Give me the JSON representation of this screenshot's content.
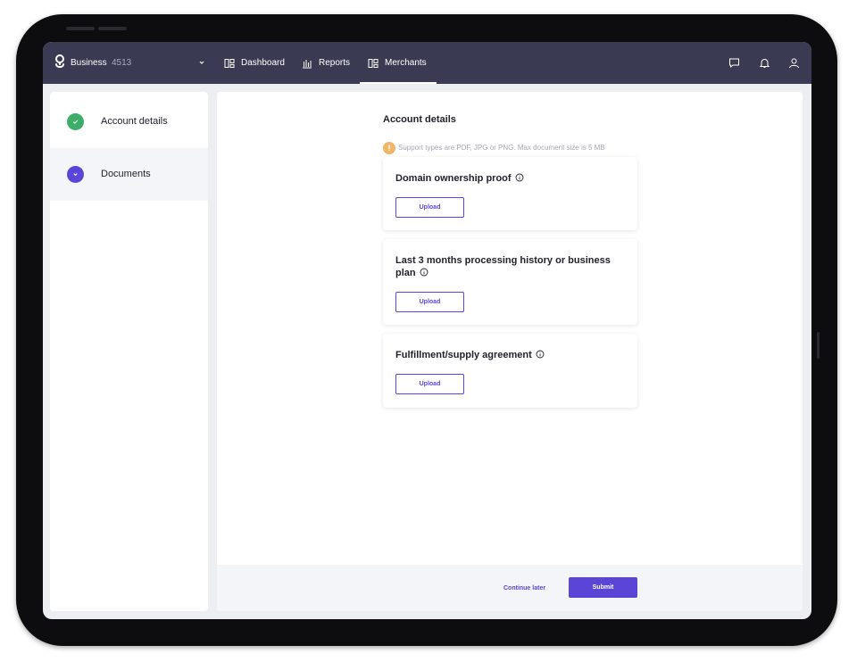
{
  "header": {
    "business_label": "Business",
    "business_number": "4513",
    "nav": [
      {
        "label": "Dashboard",
        "icon": "dashboard-icon"
      },
      {
        "label": "Reports",
        "icon": "reports-icon"
      },
      {
        "label": "Merchants",
        "icon": "merchants-icon",
        "active": true
      }
    ],
    "icons": [
      "chat-icon",
      "bell-icon",
      "user-icon"
    ]
  },
  "sidebar": {
    "steps": [
      {
        "label": "Account details",
        "status": "complete",
        "color": "#3dae6a"
      },
      {
        "label": "Documents",
        "status": "current",
        "color": "#5b45d6"
      }
    ]
  },
  "main": {
    "title": "Account details",
    "hint": "Support types are PDF, JPG or PNG. Max document size is 5 MB",
    "hint_icon": "!",
    "documents": [
      {
        "title": "Domain ownership proof",
        "button": "Upload"
      },
      {
        "title": "Last 3 months processing history or business plan",
        "button": "Upload"
      },
      {
        "title": "Fulfillment/supply agreement",
        "button": "Upload"
      }
    ],
    "footer": {
      "continue_label": "Continue later",
      "submit_label": "Submit"
    }
  },
  "colors": {
    "topbar": "#3a3b52",
    "accent": "#5b45d6",
    "success": "#3dae6a",
    "warning": "#f0b56a"
  }
}
